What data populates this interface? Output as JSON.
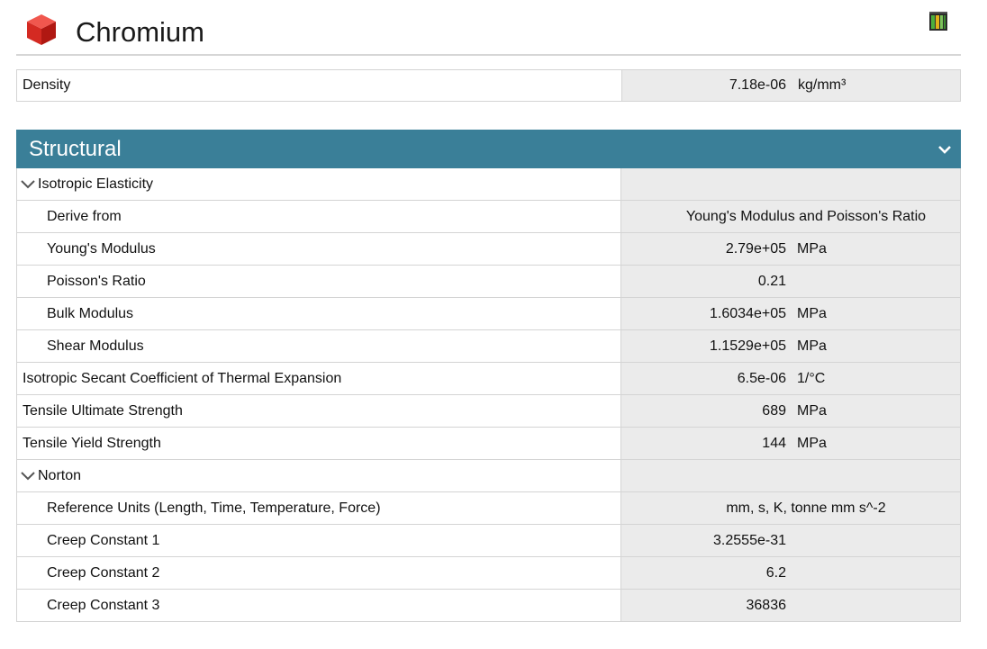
{
  "header": {
    "title": "Chromium",
    "material_icon": "red-cube-icon",
    "library_icon": "books-library-icon"
  },
  "density": {
    "label": "Density",
    "value": "7.18e-06",
    "unit": "kg/mm³"
  },
  "section": {
    "title": "Structural",
    "color": "#3a7f98",
    "chevron_icon": "chevron-down-icon"
  },
  "rows": [
    {
      "label": "Isotropic Elasticity",
      "group": true
    },
    {
      "label": "Derive from",
      "value": "Young's Modulus and Poisson's Ratio"
    },
    {
      "label": "Young's Modulus",
      "value": "2.79e+05",
      "unit": "MPa"
    },
    {
      "label": "Poisson's Ratio",
      "value": "0.21"
    },
    {
      "label": "Bulk Modulus",
      "value": "1.6034e+05",
      "unit": "MPa"
    },
    {
      "label": "Shear Modulus",
      "value": "1.1529e+05",
      "unit": "MPa"
    },
    {
      "label": "Isotropic Secant Coefficient of Thermal Expansion",
      "value": "6.5e-06",
      "unit": "1/°C"
    },
    {
      "label": "Tensile Ultimate Strength",
      "value": "689",
      "unit": "MPa"
    },
    {
      "label": "Tensile Yield Strength",
      "value": "144",
      "unit": "MPa"
    },
    {
      "label": "Norton",
      "group": true
    },
    {
      "label": "Reference Units (Length, Time, Temperature, Force)",
      "value": "mm, s, K, tonne mm s^-2"
    },
    {
      "label": "Creep Constant 1",
      "value": "3.2555e-31"
    },
    {
      "label": "Creep Constant 2",
      "value": "6.2"
    },
    {
      "label": "Creep Constant 3",
      "value": "36836"
    }
  ]
}
